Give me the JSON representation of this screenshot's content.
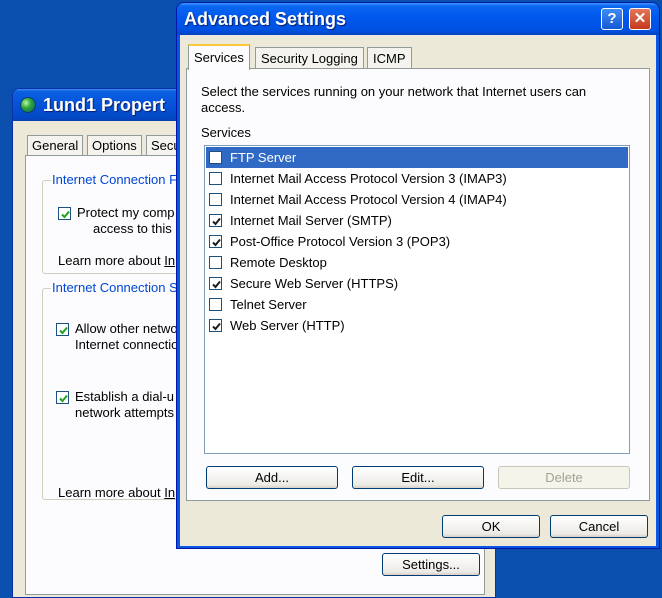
{
  "background_window": {
    "title": "1und1 Propert",
    "tabs": [
      "General",
      "Options",
      "Secu"
    ],
    "group1": {
      "title": "Internet Connection F",
      "checkbox_line1": "Protect my comp",
      "checkbox_line2": "access to this co",
      "checked": true,
      "learn_more_prefix": "Learn more about ",
      "learn_more_link": "In"
    },
    "group2": {
      "title": "Internet Connection S",
      "allow_line1": "Allow other netwo",
      "allow_line2": "Internet connectio",
      "allow_checked": true,
      "dial_line1": "Establish a dial-u",
      "dial_line2": "network attempts",
      "dial_checked": true,
      "learn_more_prefix": "Learn more about ",
      "learn_more_link": "In"
    },
    "settings_button": "Settings..."
  },
  "dialog": {
    "title": "Advanced Settings",
    "help_button": "?",
    "close_button": "✕",
    "tabs": [
      {
        "label": "Services",
        "active": true
      },
      {
        "label": "Security Logging",
        "active": false
      },
      {
        "label": "ICMP",
        "active": false
      }
    ],
    "description": "Select the services running on your network that Internet users can access.",
    "services_label": "Services",
    "services": [
      {
        "label": "FTP Server",
        "checked": false,
        "selected": true
      },
      {
        "label": "Internet Mail Access Protocol Version 3 (IMAP3)",
        "checked": false,
        "selected": false
      },
      {
        "label": "Internet Mail Access Protocol Version 4 (IMAP4)",
        "checked": false,
        "selected": false
      },
      {
        "label": "Internet Mail Server (SMTP)",
        "checked": true,
        "selected": false
      },
      {
        "label": "Post-Office Protocol Version 3 (POP3)",
        "checked": true,
        "selected": false
      },
      {
        "label": "Remote Desktop",
        "checked": false,
        "selected": false
      },
      {
        "label": "Secure Web Server (HTTPS)",
        "checked": true,
        "selected": false
      },
      {
        "label": "Telnet Server",
        "checked": false,
        "selected": false
      },
      {
        "label": "Web Server (HTTP)",
        "checked": true,
        "selected": false
      }
    ],
    "add_button": "Add...",
    "edit_button": "Edit...",
    "delete_button": "Delete",
    "delete_enabled": false,
    "ok_button": "OK",
    "cancel_button": "Cancel"
  },
  "colors": {
    "desktop": "#0a4fae",
    "titlebar": "#0058ee",
    "selection": "#316ac5",
    "group_title": "#0046d5"
  }
}
